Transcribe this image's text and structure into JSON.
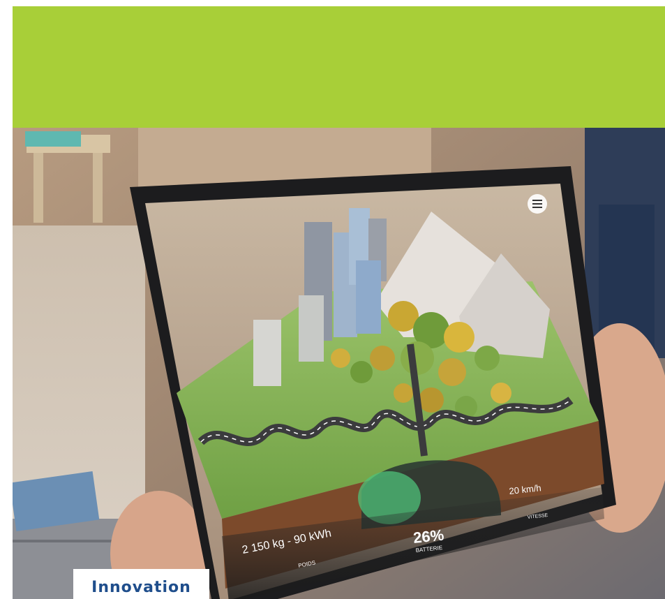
{
  "colors": {
    "banner": "#a8cf38",
    "label_text": "#1f4e8c",
    "hud_green": "#4fc27a"
  },
  "label": {
    "text": "Innovation"
  },
  "hud": {
    "weight": "2 150 kg - 90 kWh",
    "weight_caption": "POIDS",
    "battery": "26%",
    "battery_caption": "BATTERIE",
    "speed": "20 km/h",
    "speed_caption": "VITESSE"
  },
  "icons": {
    "menu": "hamburger-menu-icon"
  }
}
